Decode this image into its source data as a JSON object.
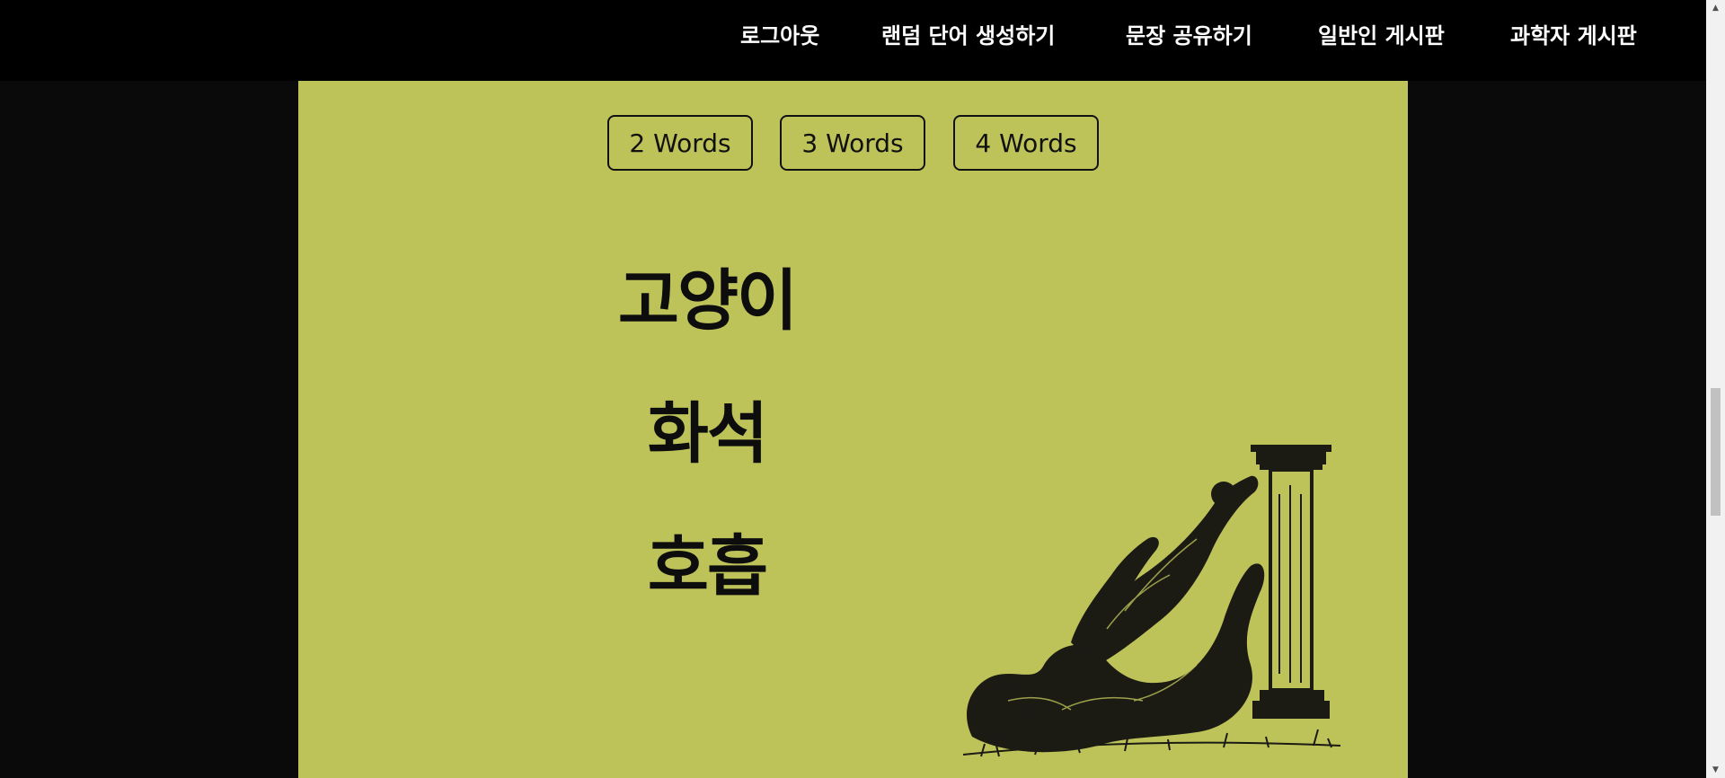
{
  "nav": {
    "items": [
      {
        "label": "로그아웃"
      },
      {
        "label": "랜덤 단어 생성하기"
      },
      {
        "label": "문장 공유하기"
      },
      {
        "label": "일반인 게시판"
      },
      {
        "label": "과학자 게시판"
      }
    ]
  },
  "word_count_buttons": [
    {
      "label": "2 Words"
    },
    {
      "label": "3 Words"
    },
    {
      "label": "4 Words"
    }
  ],
  "generated_words": [
    "고양이",
    "화석",
    "호흡"
  ],
  "colors": {
    "nav_bg": "#000000",
    "panel_bg": "#bdc259",
    "page_bg": "#0b0a0a",
    "text": "#0d0d0d"
  },
  "icons": {
    "illustration": "figure-with-column-illustration"
  }
}
